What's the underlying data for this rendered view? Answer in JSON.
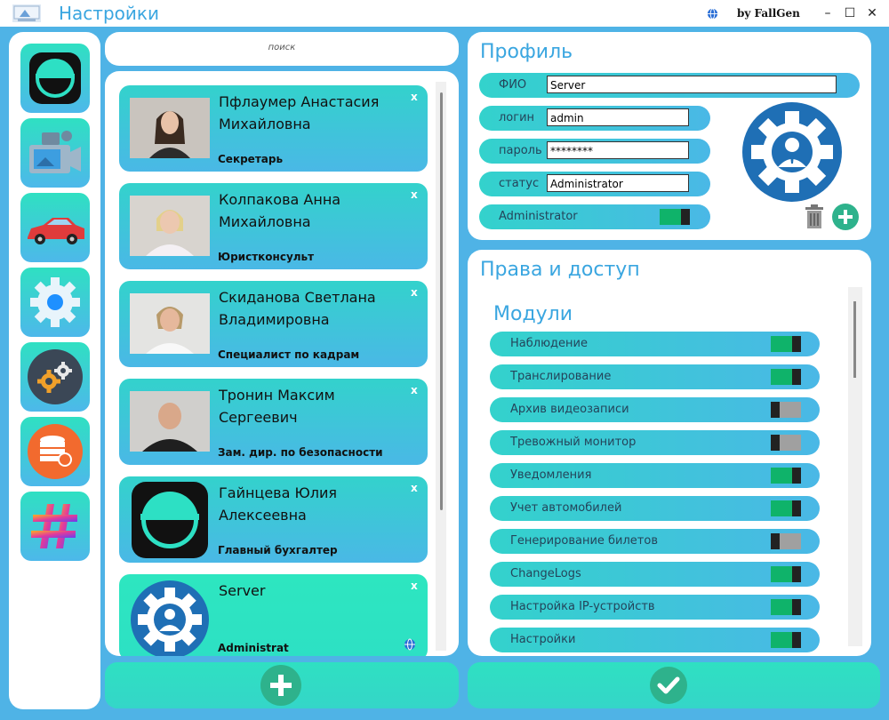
{
  "window": {
    "title": "Настройки",
    "byline": "by FallGen",
    "minimize": "–",
    "maximize": "☐",
    "close": "✕"
  },
  "search": {
    "placeholder": "поиск"
  },
  "employees": [
    {
      "name": "Пфлаумер Анастасия Михайловна",
      "role": "Секретарь",
      "close": "x",
      "photo": "woman-dark-hair"
    },
    {
      "name": "Колпакова Анна Михайловна",
      "role": "Юристконсульт",
      "close": "x",
      "photo": "woman-blonde"
    },
    {
      "name": "Скиданова Светлана Владимировна",
      "role": "Специалист по кадрам",
      "close": "x",
      "photo": "woman-light-hair"
    },
    {
      "name": "Тронин Максим Сергеевич",
      "role": "Зам. дир. по безопасности",
      "close": "x",
      "photo": "man-bald"
    },
    {
      "name": "Гайнцева Юлия Алексеевна",
      "role": "Главный бухгалтер",
      "close": "x",
      "photo": "smile-logo"
    },
    {
      "name": "Server",
      "role": "Administrat",
      "close": "x",
      "photo": "admin-gear"
    }
  ],
  "profile": {
    "title": "Профиль",
    "fields": [
      {
        "label": "ФИО",
        "value": "Server"
      },
      {
        "label": "логин",
        "value": "admin"
      },
      {
        "label": "пароль",
        "value": "********"
      },
      {
        "label": "статус",
        "value": "Administrator"
      }
    ],
    "admin_toggle": {
      "label": "Administrator",
      "on": true
    }
  },
  "rights": {
    "title": "Права и доступ",
    "modules_title": "Модули",
    "modules": [
      {
        "label": "Наблюдение",
        "on": true
      },
      {
        "label": "Транслирование",
        "on": true
      },
      {
        "label": "Архив видеозаписи",
        "on": false
      },
      {
        "label": "Тревожный монитор",
        "on": false
      },
      {
        "label": "Уведомления",
        "on": true
      },
      {
        "label": "Учет автомобилей",
        "on": true
      },
      {
        "label": "Генерирование билетов",
        "on": false
      },
      {
        "label": "ChangeLogs",
        "on": true
      },
      {
        "label": "Настройка IP-устройств",
        "on": true
      },
      {
        "label": "Настройки",
        "on": true
      }
    ]
  },
  "colors": {
    "accent": "#3aa6e0",
    "toggle_on": "#0fb36a",
    "toggle_off": "#a0a0a0",
    "round_button": "#2eb28c"
  },
  "nav_icons": [
    "smile-logo-icon",
    "video-camera-icon",
    "car-icon",
    "gear-icon",
    "gears-dark-icon",
    "database-icon",
    "hashtag-icon"
  ]
}
